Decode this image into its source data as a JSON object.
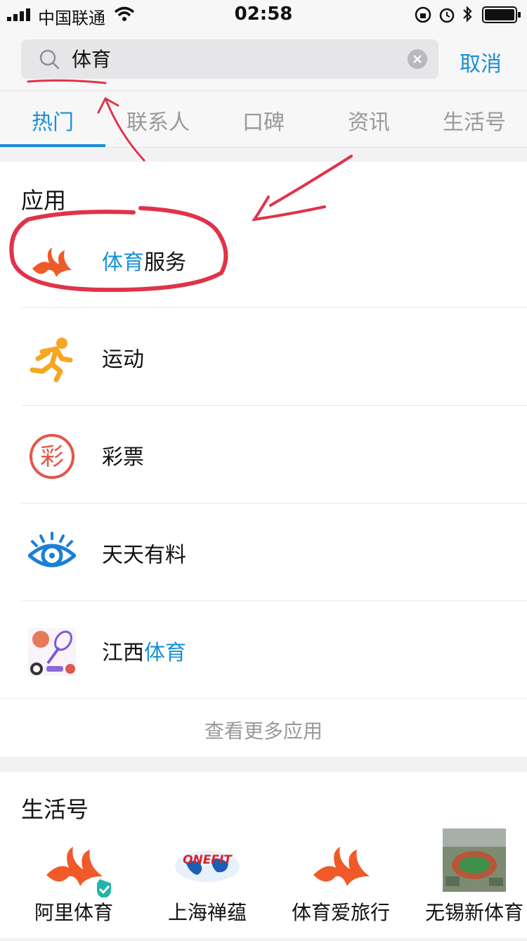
{
  "status_bar": {
    "carrier": "中国联通",
    "time": "02:58"
  },
  "search": {
    "query": "体育",
    "cancel_label": "取消"
  },
  "tabs": [
    {
      "label": "热门",
      "active": true
    },
    {
      "label": "联系人"
    },
    {
      "label": "口碑"
    },
    {
      "label": "资讯"
    },
    {
      "label": "生活号"
    }
  ],
  "apps": {
    "title": "应用",
    "items": [
      {
        "parts": [
          "体育",
          "服务"
        ],
        "highlight_first": true,
        "icon": "sports-service-icon"
      },
      {
        "parts": [
          "运动",
          ""
        ],
        "icon": "running-man-icon"
      },
      {
        "parts": [
          "彩票",
          ""
        ],
        "icon": "lottery-icon",
        "icon_text": "彩"
      },
      {
        "parts": [
          "天天有料",
          ""
        ],
        "icon": "eye-icon"
      },
      {
        "parts": [
          "江西",
          "体育"
        ],
        "highlight_second": true,
        "icon": "sports-equipment-icon"
      }
    ],
    "more_label": "查看更多应用"
  },
  "life_accounts": {
    "title": "生活号",
    "items": [
      {
        "label": "阿里体育"
      },
      {
        "label": "上海禅蕴"
      },
      {
        "label": "体育爱旅行"
      },
      {
        "label": "无锡新体育"
      }
    ],
    "logo_text": "ONEFIT"
  },
  "colors": {
    "accent": "#1a8fd6",
    "annotation_red": "#e0334a",
    "brand_orange": "#f05a28"
  }
}
